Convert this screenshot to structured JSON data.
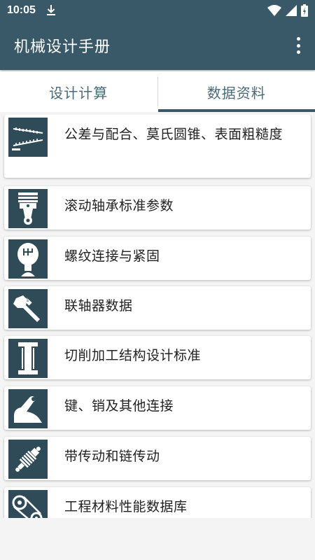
{
  "status": {
    "time": "10:05"
  },
  "app": {
    "title": "机械设计手册"
  },
  "tabs": [
    {
      "label": "设计计算",
      "active": false
    },
    {
      "label": "数据资料",
      "active": true
    }
  ],
  "items": [
    {
      "label": "公差与配合、莫氏圆锥、表面粗糙度",
      "icon": "ruler-scale-icon"
    },
    {
      "label": "滚动轴承标准参数",
      "icon": "piston-icon"
    },
    {
      "label": "螺纹连接与紧固",
      "icon": "gear-shift-icon"
    },
    {
      "label": "联轴器数据",
      "icon": "wrench-icon"
    },
    {
      "label": "切削加工结构设计标准",
      "icon": "i-beam-icon"
    },
    {
      "label": "键、销及其他连接",
      "icon": "lever-icon"
    },
    {
      "label": "带传动和链传动",
      "icon": "shock-absorber-icon"
    },
    {
      "label": "工程材料性能数据库",
      "icon": "belt-drive-icon"
    }
  ],
  "colors": {
    "primary": "#3a5968",
    "icon_bg": "#2f4b58"
  }
}
